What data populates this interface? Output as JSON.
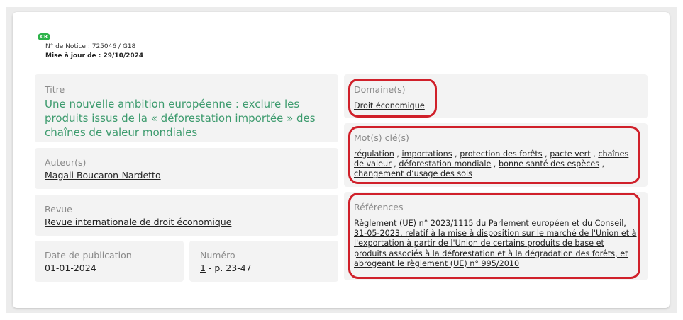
{
  "badge": "CR",
  "notice": {
    "number": "N° de Notice : 725046 / G18",
    "update": "Mise à jour de : 29/10/2024"
  },
  "titre": {
    "label": "Titre",
    "value": "Une nouvelle ambition européenne : exclure les produits issus de la « déforestation importée » des chaînes de valeur mondiales"
  },
  "auteur": {
    "label": "Auteur(s)",
    "value": "Magali Boucaron-Nardetto"
  },
  "revue": {
    "label": "Revue",
    "value": "Revue internationale de droit économique"
  },
  "date": {
    "label": "Date de publication",
    "value": "01-01-2024"
  },
  "numero": {
    "label": "Numéro",
    "link": "1",
    "rest": " - p. 23-47"
  },
  "domaine": {
    "label": "Domaine(s)",
    "value": "Droit économique"
  },
  "motscles": {
    "label": "Mot(s) clé(s)",
    "items": [
      "régulation",
      "importations",
      "protection des forêts",
      "pacte vert",
      "chaînes de valeur",
      "déforestation mondiale",
      "bonne santé des espèces",
      "changement d’usage des sols"
    ]
  },
  "references": {
    "label": "Références",
    "value": "Règlement (UE) n° 2023/1115 du Parlement européen et du Conseil, 31-05-2023, relatif à la mise à disposition sur le marché de l'Union et à l'exportation à partir de l'Union de certains produits de base et produits associés à la déforestation et à la dégradation des forêts, et abrogeant le règlement (UE) n° 995/2010"
  },
  "colors": {
    "title_green": "#3d9b6e",
    "highlight_red": "#d0202a",
    "badge_green": "#2db34a"
  }
}
